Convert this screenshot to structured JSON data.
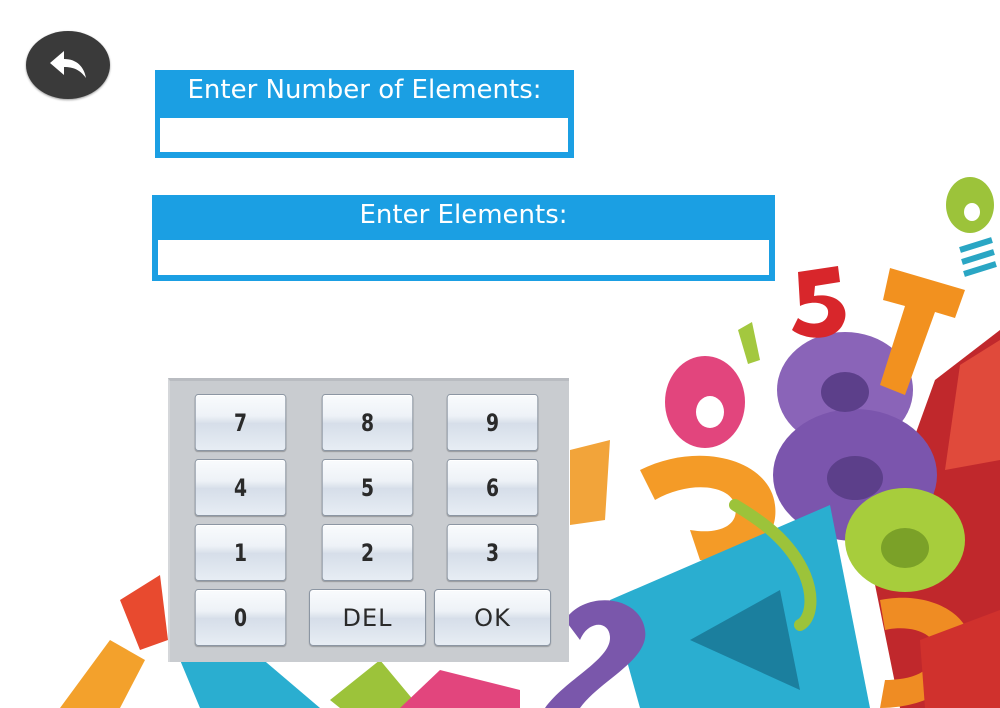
{
  "header": {
    "back_icon": "back-arrow-icon"
  },
  "form": {
    "count_label": "Enter Number of Elements:",
    "count_value": "",
    "elements_label": "Enter Elements:",
    "elements_value": ""
  },
  "keypad": {
    "keys": [
      {
        "label": "7"
      },
      {
        "label": "8"
      },
      {
        "label": "9"
      },
      {
        "label": "4"
      },
      {
        "label": "5"
      },
      {
        "label": "6"
      },
      {
        "label": "1"
      },
      {
        "label": "2"
      },
      {
        "label": "3"
      },
      {
        "label": "0"
      },
      {
        "label": "DEL"
      },
      {
        "label": "OK"
      }
    ]
  },
  "colors": {
    "accent": "#1b9fe3",
    "back_button": "#3a3a3a",
    "keypad_bg": "#c9ccd0"
  }
}
